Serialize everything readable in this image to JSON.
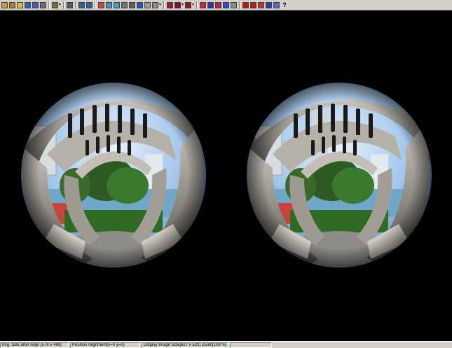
{
  "toolbar": {
    "buttons": [
      {
        "name": "open-icon",
        "color": "#c89b3c"
      },
      {
        "name": "open-multi-icon",
        "color": "#b07830"
      },
      {
        "name": "folder-icon",
        "color": "#e0b84a"
      },
      {
        "name": "save-icon",
        "color": "#3b5fb5"
      },
      {
        "name": "save-as-icon",
        "color": "#3b5fb5"
      },
      {
        "name": "print-icon",
        "color": "#6f6f6f"
      },
      {
        "name": "sep"
      },
      {
        "name": "crop-icon",
        "color": "#7a6a3a"
      },
      {
        "name": "drop"
      },
      {
        "name": "sep"
      },
      {
        "name": "grid-icon",
        "color": "#5a5a5a"
      },
      {
        "name": "sep"
      },
      {
        "name": "undo-icon",
        "color": "#2f5fa5"
      },
      {
        "name": "redo-icon",
        "color": "#2f5fa5"
      },
      {
        "name": "sep"
      },
      {
        "name": "color-wheel-icon",
        "color": "#c8463c"
      },
      {
        "name": "stereo-anaglyph-icon",
        "color": "#3f8fd8"
      },
      {
        "name": "side-by-side-icon",
        "color": "#3fa0c0"
      },
      {
        "name": "frame-icon",
        "color": "#707070"
      },
      {
        "name": "cross-icon",
        "color": "#606060"
      },
      {
        "name": "swap-icon",
        "color": "#2a4fc0"
      },
      {
        "name": "interlace-icon",
        "color": "#9a9a9a"
      },
      {
        "name": "layout-icon",
        "color": "#8a8a8a"
      },
      {
        "name": "drop"
      },
      {
        "name": "sep"
      },
      {
        "name": "red-icon",
        "color": "#9b1b30"
      },
      {
        "name": "dark-red-icon",
        "color": "#7a1030"
      },
      {
        "name": "drop"
      },
      {
        "name": "maroon-icon",
        "color": "#8a1a2a"
      },
      {
        "name": "drop"
      },
      {
        "name": "sep"
      },
      {
        "name": "red-blue-icon",
        "color": "#c8283c"
      },
      {
        "name": "blue-red-icon",
        "color": "#3030c0"
      },
      {
        "name": "red-cyan-icon",
        "color": "#c02030"
      },
      {
        "name": "cyan-icon",
        "color": "#2a50c8"
      },
      {
        "name": "gray-icon",
        "color": "#8a8a8a"
      },
      {
        "name": "sep"
      },
      {
        "name": "lens-icon",
        "color": "#c01818"
      },
      {
        "name": "lens-gear-icon",
        "color": "#b02020"
      },
      {
        "name": "hash-icon",
        "color": "#c03030"
      },
      {
        "name": "bars-icon",
        "color": "#2a40b0"
      },
      {
        "name": "move-icon",
        "color": "#4a70c0"
      }
    ],
    "help_label": "?"
  },
  "status": {
    "size_after_align": "Img. Size after Align [576 x 480]",
    "position_alignment": "Position Alignment(x=0 y=0)",
    "display_size": "Display Image Size[627 x 523]  Zoom[109 %]"
  }
}
